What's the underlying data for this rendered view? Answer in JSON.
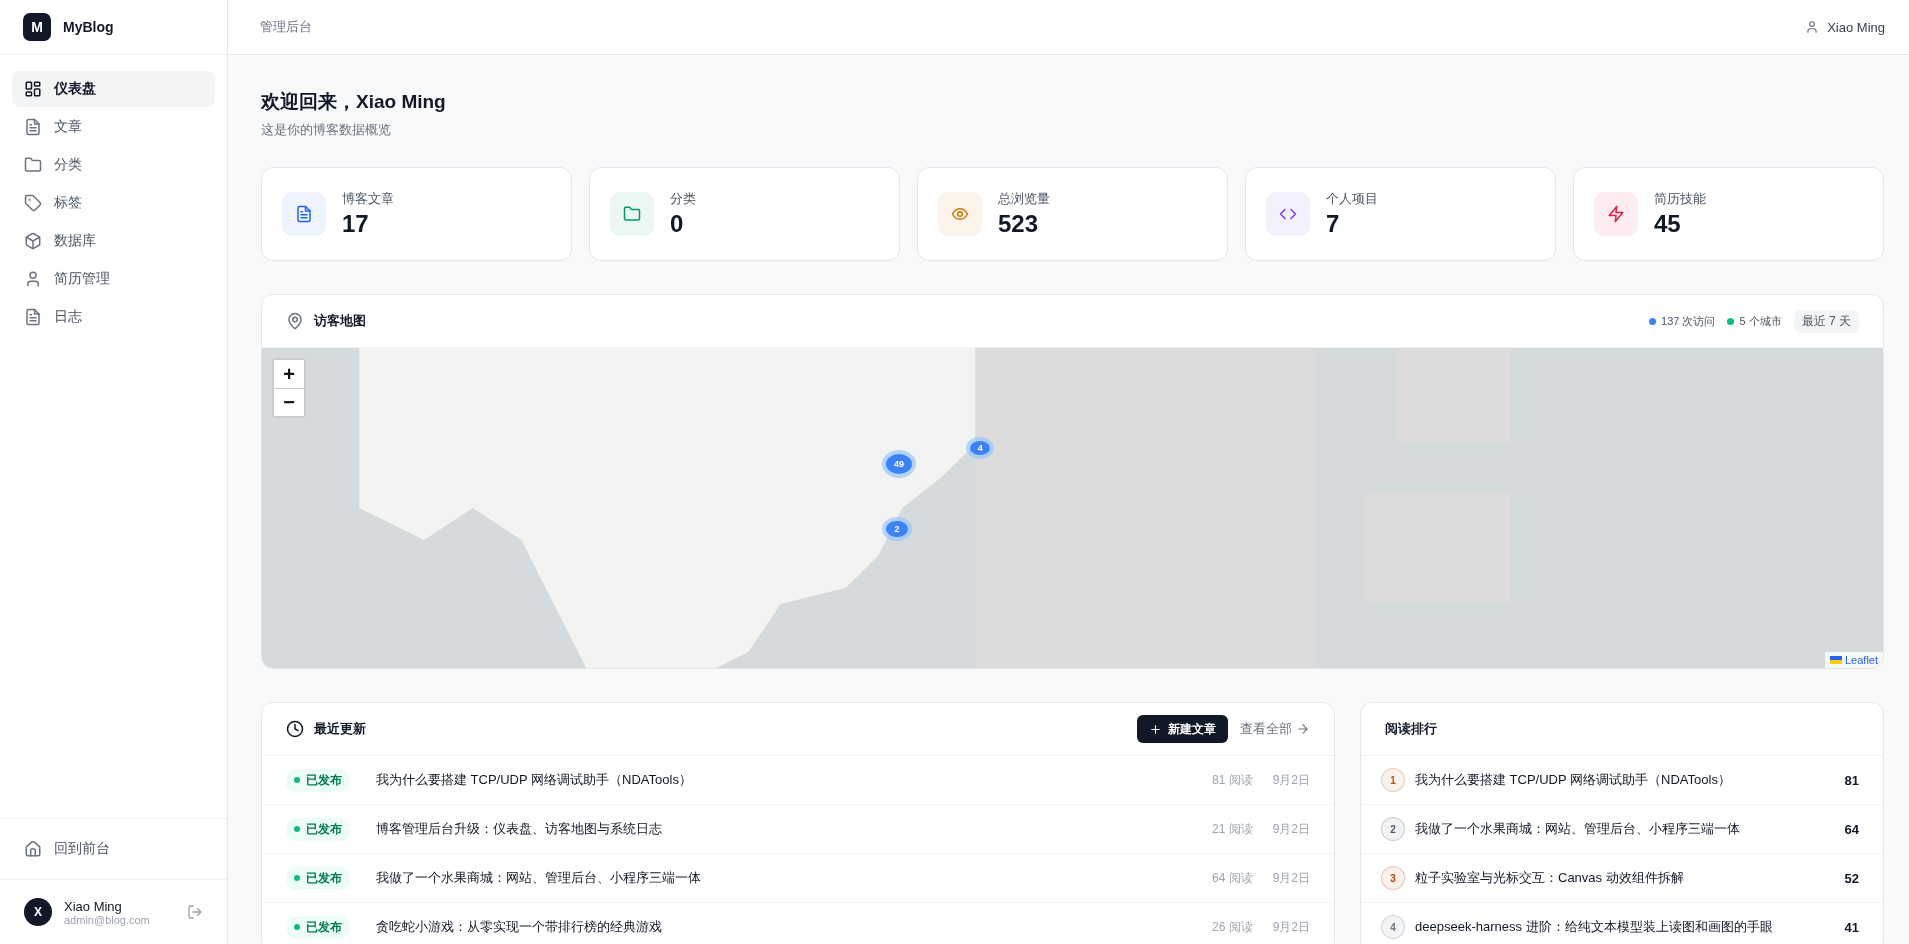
{
  "sidebar": {
    "logo": "M",
    "brand": "MyBlog",
    "items": [
      {
        "label": "仪表盘",
        "selected": true
      },
      {
        "label": "文章",
        "selected": false
      },
      {
        "label": "分类",
        "selected": false
      },
      {
        "label": "标签",
        "selected": false
      },
      {
        "label": "数据库",
        "selected": false
      },
      {
        "label": "简历管理",
        "selected": false
      },
      {
        "label": "日志",
        "selected": false
      }
    ],
    "back_link": "回到前台",
    "user": {
      "initial": "X",
      "name": "Xiao Ming",
      "email": "admin@blog.com"
    }
  },
  "header": {
    "title": "管理后台",
    "user": "Xiao Ming"
  },
  "welcome": {
    "title": "欢迎回来，Xiao Ming",
    "subtitle": "这是你的博客数据概览"
  },
  "stats": [
    {
      "label": "博客文章",
      "value": "17"
    },
    {
      "label": "分类",
      "value": "0"
    },
    {
      "label": "总浏览量",
      "value": "523"
    },
    {
      "label": "个人项目",
      "value": "7"
    },
    {
      "label": "简历技能",
      "value": "45"
    }
  ],
  "visitor_map": {
    "title": "访客地图",
    "legend": [
      {
        "label": "137 次访问",
        "color": "#3b82f6"
      },
      {
        "label": "5 个城市",
        "color": "#10b981"
      }
    ],
    "range": "最近 7 天",
    "zoom_in": "+",
    "zoom_out": "−",
    "clusters": [
      {
        "count": "49"
      },
      {
        "count": "4"
      },
      {
        "count": "2"
      }
    ],
    "attribution": "Leaflet"
  },
  "recent": {
    "title": "最近更新",
    "new_button": "新建文章",
    "view_all": "查看全部",
    "rows": [
      {
        "status": "已发布",
        "title": "我为什么要搭建 TCP/UDP 网络调试助手（NDATools）",
        "reads": "81 阅读",
        "date": "9月2日"
      },
      {
        "status": "已发布",
        "title": "博客管理后台升级：仪表盘、访客地图与系统日志",
        "reads": "21 阅读",
        "date": "9月2日"
      },
      {
        "status": "已发布",
        "title": "我做了一个水果商城：网站、管理后台、小程序三端一体",
        "reads": "64 阅读",
        "date": "9月2日"
      },
      {
        "status": "已发布",
        "title": "贪吃蛇小游戏：从零实现一个带排行榜的经典游戏",
        "reads": "26 阅读",
        "date": "9月2日"
      }
    ]
  },
  "ranking": {
    "title": "阅读排行",
    "rows": [
      {
        "rank": "1",
        "title": "我为什么要搭建 TCP/UDP 网络调试助手（NDATools）",
        "count": "81",
        "color": "#b45309"
      },
      {
        "rank": "2",
        "title": "我做了一个水果商城：网站、管理后台、小程序三端一体",
        "count": "64",
        "color": "#4b5563"
      },
      {
        "rank": "3",
        "title": "粒子实验室与光标交互：Canvas 动效组件拆解",
        "count": "52",
        "color": "#c2410c"
      },
      {
        "rank": "4",
        "title": "deepseek-harness 进阶：给纯文本模型装上读图和画图的手眼",
        "count": "41",
        "color": "#6b7280"
      }
    ]
  }
}
